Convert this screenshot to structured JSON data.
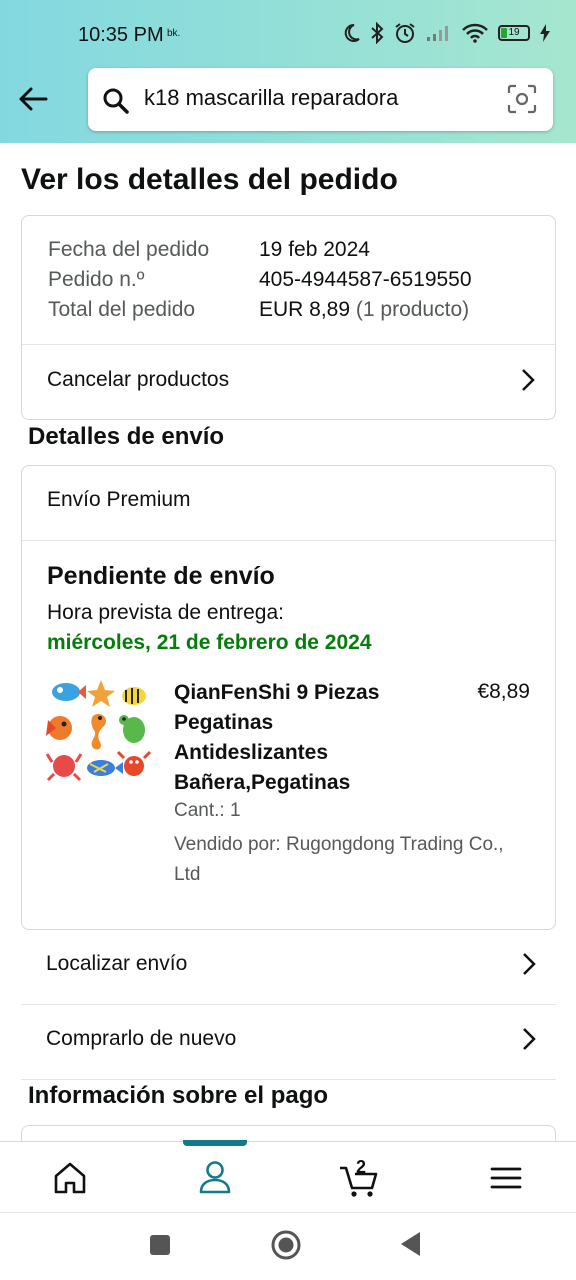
{
  "status_bar": {
    "time": "10:35 PM",
    "time_suffix": "bk.",
    "battery_level": "19",
    "icons": [
      "moon-icon",
      "bluetooth-icon",
      "alarm-icon",
      "cell-signal-icon",
      "wifi-icon",
      "battery-icon",
      "charging-icon"
    ]
  },
  "search": {
    "query": "k18 mascarilla reparadora"
  },
  "page": {
    "title": "Ver los detalles del pedido"
  },
  "order_summary": {
    "rows": [
      {
        "label": "Fecha del pedido",
        "value": "19 feb 2024"
      },
      {
        "label": "Pedido n.º",
        "value": "405-4944587-6519550"
      },
      {
        "label": "Total del pedido",
        "value": "EUR 8,89",
        "note": "(1 producto)"
      }
    ],
    "cancel_label": "Cancelar productos"
  },
  "shipping": {
    "section_title": "Detalles de envío",
    "method": "Envío Premium",
    "status": "Pendiente de envío",
    "eta_label": "Hora prevista de entrega:",
    "eta_date": "miércoles, 21 de febrero de 2024",
    "item": {
      "name": "QianFenShi 9 Piezas Pegatinas Antideslizantes Bañera,Pegatinas",
      "price": "€8,89",
      "quantity": "Cant.: 1",
      "seller": "Vendido por: Rugongdong Trading Co., Ltd"
    }
  },
  "actions": {
    "track": "Localizar envío",
    "buy_again": "Comprarlo de nuevo"
  },
  "payment": {
    "section_title": "Información sobre el pago"
  },
  "bottom_nav": {
    "cart_count": "2",
    "active_tab": "account",
    "accent_color": "#117b89"
  },
  "colors": {
    "header_gradient_start": "#83d8e0",
    "header_gradient_end": "#a6e6cf",
    "delivery_green": "#067d0b"
  }
}
